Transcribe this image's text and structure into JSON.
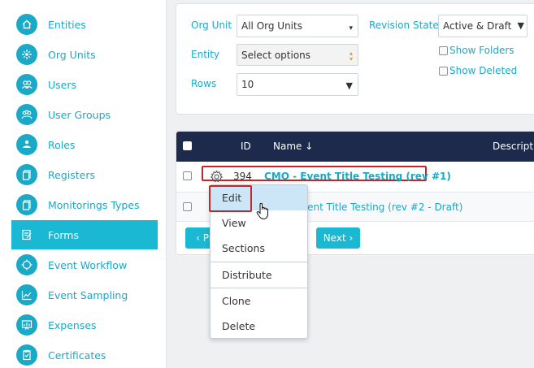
{
  "sidebar": {
    "items": [
      {
        "label": "Entities",
        "icon": "home-icon"
      },
      {
        "label": "Org Units",
        "icon": "org-units-icon"
      },
      {
        "label": "Users",
        "icon": "users-icon"
      },
      {
        "label": "User Groups",
        "icon": "user-groups-icon"
      },
      {
        "label": "Roles",
        "icon": "roles-icon"
      },
      {
        "label": "Registers",
        "icon": "registers-icon"
      },
      {
        "label": "Monitorings Types",
        "icon": "monitoring-types-icon"
      },
      {
        "label": "Forms",
        "icon": "forms-icon",
        "active": true
      },
      {
        "label": "Event Workflow",
        "icon": "event-workflow-icon"
      },
      {
        "label": "Event Sampling",
        "icon": "event-sampling-icon"
      },
      {
        "label": "Expenses",
        "icon": "expenses-icon"
      },
      {
        "label": "Certificates",
        "icon": "certificates-icon"
      }
    ]
  },
  "filters": {
    "org_unit_label": "Org Unit",
    "org_unit_value": "All Org Units",
    "entity_label": "Entity",
    "entity_placeholder": "Select options",
    "rows_label": "Rows",
    "rows_value": "10",
    "revision_state_label": "Revision State",
    "revision_state_value": "Active & Draft",
    "show_folders_label": "Show Folders",
    "show_deleted_label": "Show Deleted"
  },
  "table": {
    "headers": {
      "id": "ID",
      "name": "Name ↓",
      "description": "Description"
    },
    "rows": [
      {
        "id": "394",
        "name": "CMO - Event Title Testing (rev #1)"
      },
      {
        "id": "",
        "name": "vent Title Testing (rev #2 - Draft)"
      }
    ]
  },
  "pagination": {
    "prev_label": "‹ Pre",
    "next_label": "Next ›"
  },
  "context_menu": {
    "items": [
      "Edit",
      "View",
      "Sections",
      "Distribute",
      "Clone",
      "Delete"
    ]
  },
  "colors": {
    "accent": "#1ab8d2",
    "header": "#1e2a4b",
    "highlight": "#c0272d"
  }
}
